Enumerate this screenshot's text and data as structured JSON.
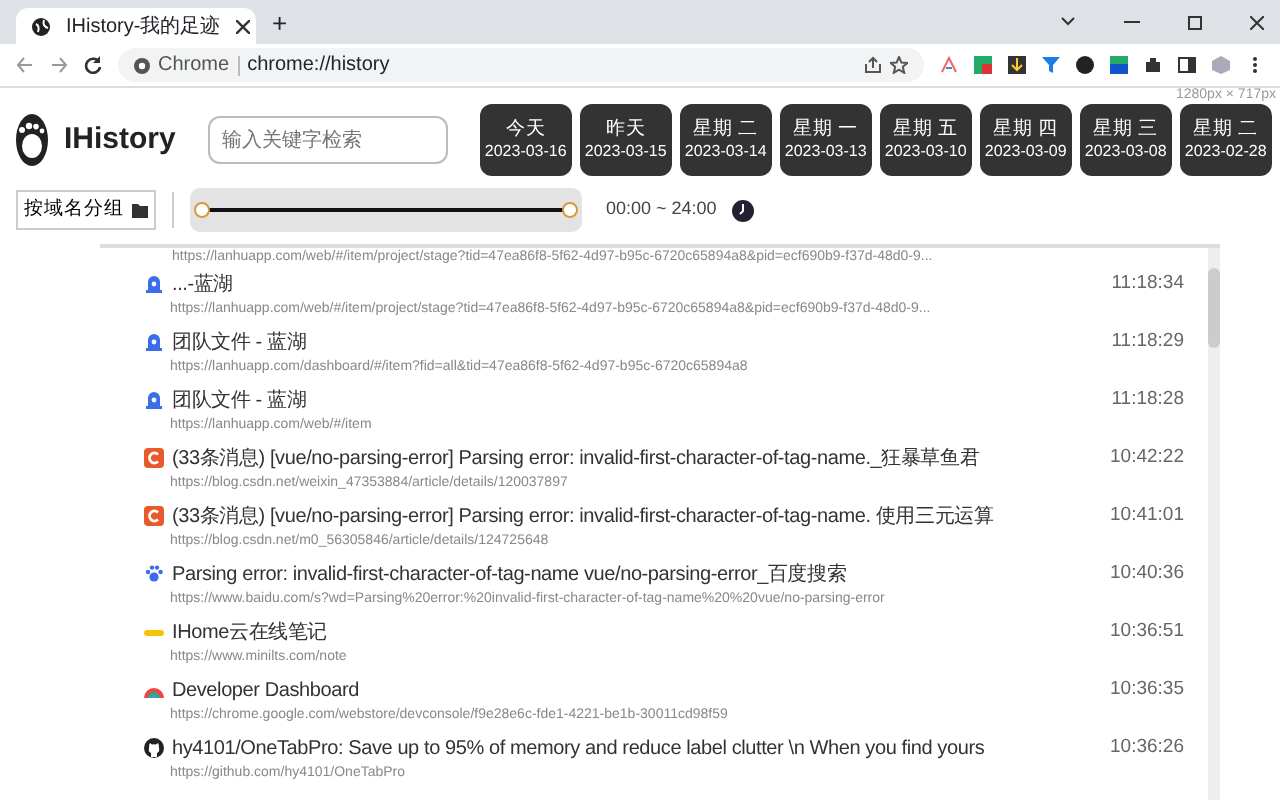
{
  "browser": {
    "tab_title": "IHistory-我的足迹",
    "site_label": "Chrome",
    "address": "chrome://history",
    "new_tab": "+",
    "size_label": "1280px × 717px"
  },
  "header": {
    "app_name": "IHistory",
    "search": {
      "placeholder": "输入关键字检索"
    },
    "dates": [
      {
        "day": "今天",
        "date": "2023-03-16",
        "selected": false
      },
      {
        "day": "昨天",
        "date": "2023-03-15",
        "selected": false
      },
      {
        "day": "星期 二",
        "date": "2023-03-14",
        "selected": false
      },
      {
        "day": "星期 一",
        "date": "2023-03-13",
        "selected": false
      },
      {
        "day": "星期 五",
        "date": "2023-03-10",
        "selected": false
      },
      {
        "day": "星期 四",
        "date": "2023-03-09",
        "selected": false
      },
      {
        "day": "星期 三",
        "date": "2023-03-08",
        "selected": false
      },
      {
        "day": "星期 二",
        "date": "2023-02-28",
        "selected": false
      }
    ]
  },
  "toolbar": {
    "group_button": "按域名分组",
    "slider": {
      "thumbs": [
        {
          "level": 0
        },
        {
          "level": 1
        }
      ]
    },
    "time_range": "00:00 ~ 24:00"
  },
  "top_fragment": "https://lanhuapp.com/web/#/item/project/stage?tid=47ea86f8-5f62-4d97-b95c-6720c65894a8&pid=ecf690b9-f37d-48d0-9...",
  "entries": [
    {
      "kind": "bell",
      "title": "...-蓝湖",
      "url": "https://lanhuapp.com/web/#/item/project/stage?tid=47ea86f8-5f62-4d97-b95c-6720c65894a8&pid=ecf690b9-f37d-48d0-9...",
      "time": "11:18:34"
    },
    {
      "kind": "bell",
      "title": "团队文件 - 蓝湖",
      "url": "https://lanhuapp.com/dashboard/#/item?fid=all&tid=47ea86f8-5f62-4d97-b95c-6720c65894a8",
      "time": "11:18:29"
    },
    {
      "kind": "bell",
      "title": "团队文件 - 蓝湖",
      "url": "https://lanhuapp.com/web/#/item",
      "time": "11:18:28"
    },
    {
      "kind": "letter-c",
      "title": "(33条消息) [vue/no-parsing-error] Parsing error: invalid-first-character-of-tag-name._狂暴草鱼君",
      "url": "https://blog.csdn.net/weixin_47353884/article/details/120037897",
      "time": "10:42:22"
    },
    {
      "kind": "letter-c",
      "title": "(33条消息) [vue/no-parsing-error] Parsing error: invalid-first-character-of-tag-name. 使用三元运算",
      "url": "https://blog.csdn.net/m0_56305846/article/details/124725648",
      "time": "10:41:01"
    },
    {
      "kind": "paw",
      "title": "Parsing error: invalid-first-character-of-tag-name vue/no-parsing-error_百度搜索",
      "url": "https://www.baidu.com/s?wd=Parsing%20error:%20invalid-first-character-of-tag-name%20%20vue/no-parsing-error",
      "time": "10:40:36"
    },
    {
      "kind": "bar",
      "title": "IHome云在线笔记",
      "url": "https://www.minilts.com/note",
      "time": "10:36:51"
    },
    {
      "kind": "rainbow",
      "title": "Developer Dashboard",
      "url": "https://chrome.google.com/webstore/devconsole/f9e28e6c-fde1-4221-be1b-30011cd98f59",
      "time": "10:36:35"
    },
    {
      "kind": "cat",
      "title": "hy4101/OneTabPro: Save up to 95% of memory and reduce label clutter \\n When you find yours",
      "url": "https://github.com/hy4101/OneTabPro",
      "time": "10:36:26"
    }
  ]
}
